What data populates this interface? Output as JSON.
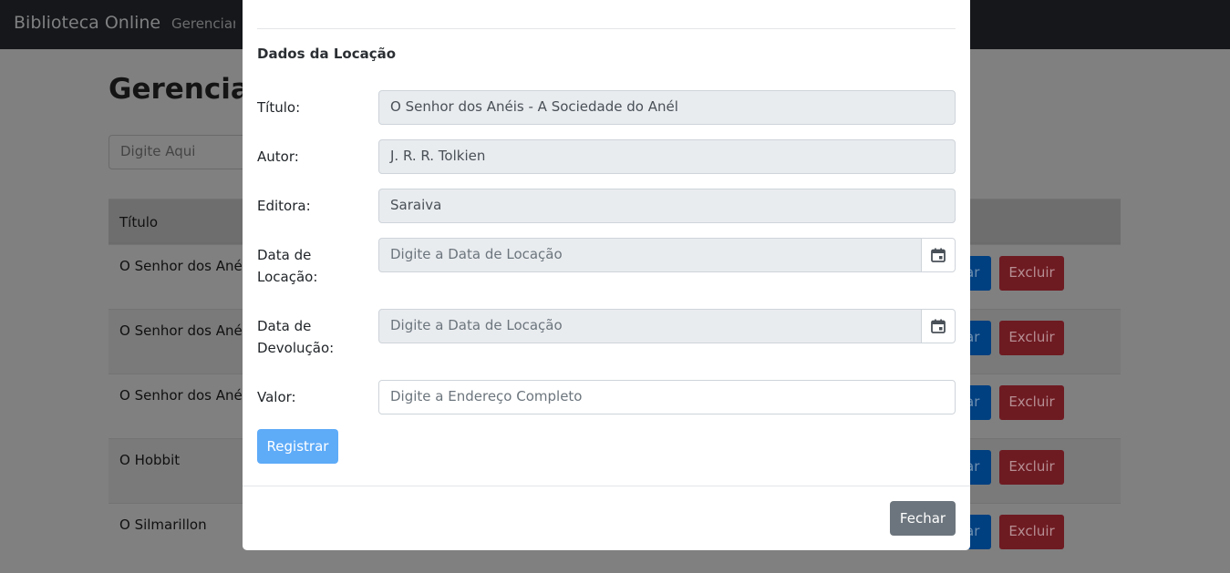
{
  "navbar": {
    "brand": "Biblioteca Online",
    "link": "Gerenciar C"
  },
  "page": {
    "title": "Gerenciar",
    "search_placeholder": "Digite Aqui",
    "table_header": "Título",
    "rows": [
      {
        "title": "O Senhor dos Anéis",
        "edit": "ar",
        "delete": "Excluir"
      },
      {
        "title": "O Senhor dos Anéis",
        "edit": "ar",
        "delete": "Excluir"
      },
      {
        "title": "O Senhor dos Anéis",
        "edit": "ar",
        "delete": "Excluir"
      },
      {
        "title": "O Hobbit",
        "edit": "ar",
        "delete": "Excluir"
      },
      {
        "title": "O Silmarillon",
        "edit": "ar",
        "delete": "Excluir"
      }
    ]
  },
  "modal": {
    "section_title": "Dados da Locação",
    "fields": {
      "titulo": {
        "label": "Título:",
        "value": "O Senhor dos Anéis - A Sociedade do Anél"
      },
      "autor": {
        "label": "Autor:",
        "value": "J. R. R. Tolkien"
      },
      "editora": {
        "label": "Editora:",
        "value": "Saraiva"
      },
      "data_locacao": {
        "label_line1": "Data de",
        "label_line2": "Locação:",
        "placeholder": "Digite a Data de Locação"
      },
      "data_devolucao": {
        "label_line1": "Data de",
        "label_line2": "Devolução:",
        "placeholder": "Digite a Data de Locação"
      },
      "valor": {
        "label": "Valor:",
        "placeholder": "Digite a Endereço Completo"
      }
    },
    "register_button": "Registrar",
    "close_button": "Fechar"
  },
  "colors": {
    "primary": "#5eabf8",
    "secondary": "#6c757d",
    "navbar": "#15171a",
    "danger_dimmed": "#6e1a21"
  },
  "icons": {
    "calendar": "calendar-icon"
  }
}
